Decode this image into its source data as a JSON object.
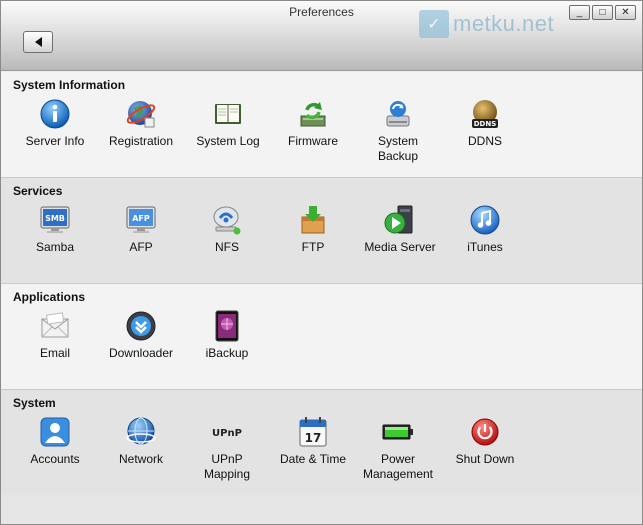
{
  "window": {
    "title": "Preferences",
    "watermark": "metku.net",
    "controls": [
      "_",
      "□",
      "✕"
    ]
  },
  "sections": [
    {
      "title": "System Information",
      "items": [
        {
          "label": "Server Info",
          "icon": "info-icon"
        },
        {
          "label": "Registration",
          "icon": "registration-globe-icon"
        },
        {
          "label": "System Log",
          "icon": "log-book-icon"
        },
        {
          "label": "Firmware",
          "icon": "firmware-update-icon"
        },
        {
          "label": "System\nBackup",
          "icon": "system-backup-icon"
        },
        {
          "label": "DDNS",
          "icon": "ddns-icon"
        }
      ]
    },
    {
      "title": "Services",
      "items": [
        {
          "label": "Samba",
          "icon": "smb-monitor-icon"
        },
        {
          "label": "AFP",
          "icon": "afp-monitor-icon"
        },
        {
          "label": "NFS",
          "icon": "nfs-icon"
        },
        {
          "label": "FTP",
          "icon": "ftp-box-icon"
        },
        {
          "label": "Media Server",
          "icon": "media-server-icon"
        },
        {
          "label": "iTunes",
          "icon": "itunes-icon"
        }
      ]
    },
    {
      "title": "Applications",
      "items": [
        {
          "label": "Email",
          "icon": "email-envelope-icon"
        },
        {
          "label": "Downloader",
          "icon": "downloader-icon"
        },
        {
          "label": "iBackup",
          "icon": "ibackup-tablet-icon"
        }
      ]
    },
    {
      "title": "System",
      "items": [
        {
          "label": "Accounts",
          "icon": "accounts-user-icon"
        },
        {
          "label": "Network",
          "icon": "network-globe-icon"
        },
        {
          "label": "UPnP\nMapping",
          "icon": "upnp-icon"
        },
        {
          "label": "Date & Time",
          "icon": "calendar-icon"
        },
        {
          "label": "Power\nManagement",
          "icon": "battery-icon"
        },
        {
          "label": "Shut Down",
          "icon": "power-off-icon"
        }
      ]
    }
  ],
  "icon_text": {
    "smb": "SMB",
    "afp": "AFP",
    "ddns": "DDNS",
    "upnp": "UPnP",
    "calendar_day": "17"
  }
}
